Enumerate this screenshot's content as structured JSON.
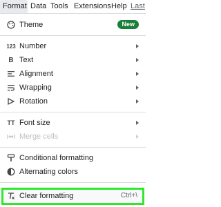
{
  "menubar": {
    "items": [
      "Format",
      "Data",
      "Tools",
      "Extensions",
      "Help",
      "Last"
    ]
  },
  "menu": {
    "theme": {
      "label": "Theme",
      "badge": "New",
      "icon": "palette-icon"
    },
    "number": {
      "label": "Number",
      "icon_text": "123"
    },
    "text": {
      "label": "Text",
      "icon_text": "B"
    },
    "alignment": {
      "label": "Alignment",
      "icon": "align-left-icon"
    },
    "wrapping": {
      "label": "Wrapping",
      "icon": "text-wrap-icon"
    },
    "rotation": {
      "label": "Rotation",
      "icon": "text-rotation-icon"
    },
    "font_size": {
      "label": "Font size",
      "icon_text": "TT"
    },
    "merge_cells": {
      "label": "Merge cells",
      "icon": "merge-cells-icon"
    },
    "conditional_formatting": {
      "label": "Conditional formatting",
      "icon": "paint-roller-icon"
    },
    "alternating_colors": {
      "label": "Alternating colors",
      "icon": "half-circle-icon"
    },
    "clear_formatting": {
      "label": "Clear formatting",
      "shortcut": "Ctrl+\\",
      "icon": "clear-format-icon"
    }
  },
  "colors": {
    "highlight_border": "#2ee82e",
    "badge_bg": "#188038"
  }
}
